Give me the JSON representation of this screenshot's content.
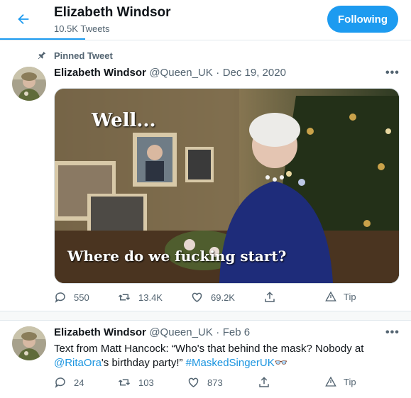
{
  "header": {
    "title": "Elizabeth Windsor",
    "subtitle": "10.5K Tweets",
    "follow_label": "Following",
    "back_icon": "arrow-left-icon",
    "accent": "#1d9bf0"
  },
  "tweets": [
    {
      "pinned_label": "Pinned Tweet",
      "name": "Elizabeth Windsor",
      "handle": "@Queen_UK",
      "dot": "·",
      "date": "Dec 19, 2020",
      "more": "•••",
      "media": {
        "caption_top": "Well...",
        "caption_bottom": "Where do we fucking start?"
      },
      "actions": {
        "reply": "550",
        "retweet": "13.4K",
        "like": "69.2K",
        "tip": "Tip"
      }
    },
    {
      "name": "Elizabeth Windsor",
      "handle": "@Queen_UK",
      "dot": "·",
      "date": "Feb 6",
      "more": "•••",
      "text_part1": "Text from Matt Hancock: “Who's that behind the mask? Nobody at",
      "mention": "@RitaOra",
      "text_part2": "'s birthday party!” ",
      "hashtag": "#MaskedSingerUK",
      "emoji": "👓",
      "actions": {
        "reply": "24",
        "retweet": "103",
        "like": "873",
        "tip": "Tip"
      }
    }
  ]
}
